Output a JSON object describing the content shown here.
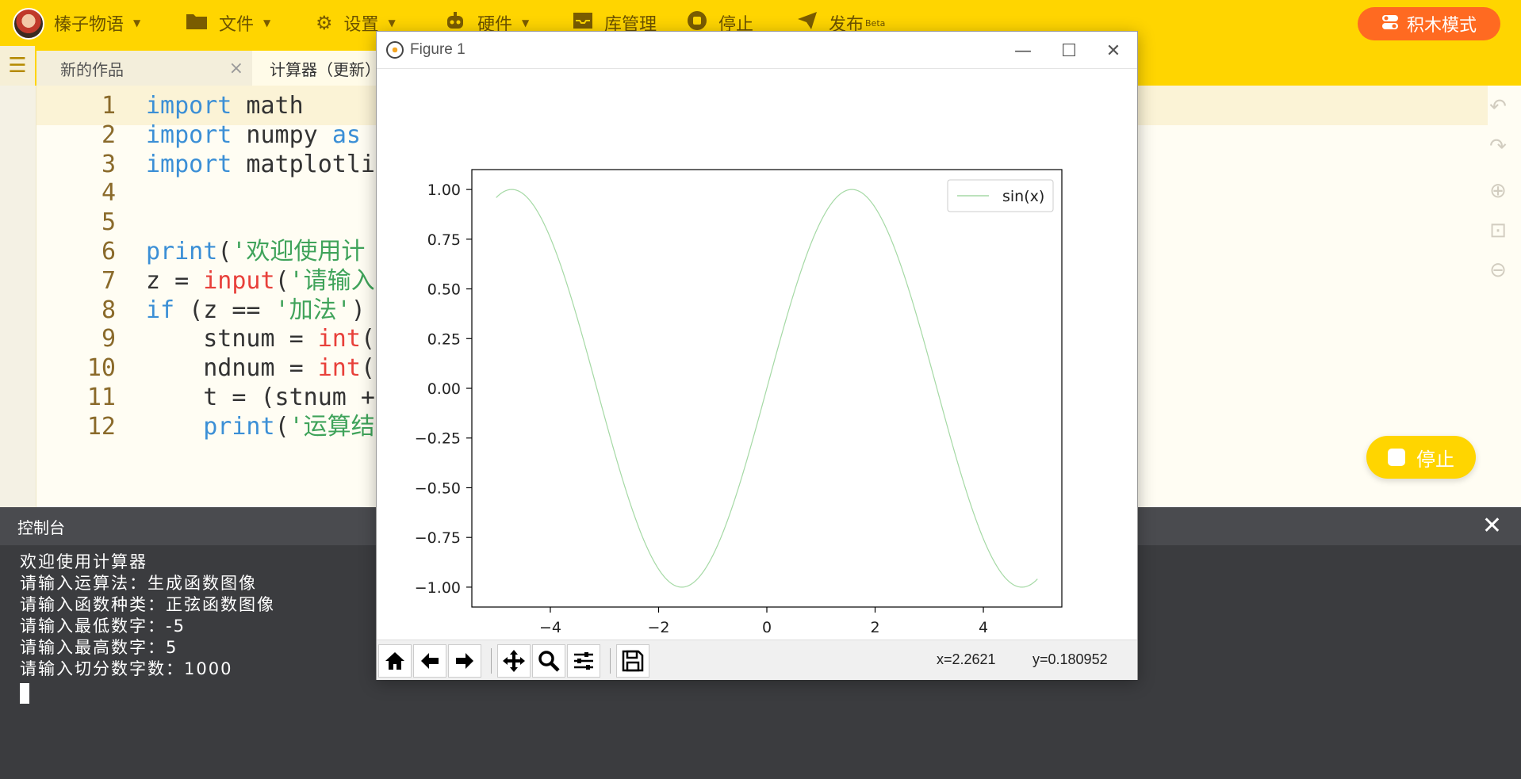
{
  "topbar": {
    "project_label": "榛子物语",
    "file_label": "文件",
    "settings_label": "设置",
    "hardware_label": "硬件",
    "library_label": "库管理",
    "stop_label": "停止",
    "publish_label": "发布",
    "publish_badge": "Beta",
    "mode_label": "积木模式"
  },
  "tabs": [
    {
      "label": "新的作品",
      "close": "×"
    },
    {
      "label": "计算器（更新）"
    }
  ],
  "editor": {
    "lines": [
      {
        "n": "1",
        "segments": [
          {
            "t": "import",
            "c": "kw"
          },
          {
            "t": " math",
            "c": ""
          }
        ]
      },
      {
        "n": "2",
        "segments": [
          {
            "t": "import",
            "c": "kw"
          },
          {
            "t": " numpy ",
            "c": ""
          },
          {
            "t": "as",
            "c": "kw"
          }
        ]
      },
      {
        "n": "3",
        "segments": [
          {
            "t": "import",
            "c": "kw"
          },
          {
            "t": " matplotli",
            "c": ""
          }
        ]
      },
      {
        "n": "4",
        "segments": []
      },
      {
        "n": "5",
        "segments": []
      },
      {
        "n": "6",
        "segments": [
          {
            "t": "print",
            "c": "kw"
          },
          {
            "t": "(",
            "c": ""
          },
          {
            "t": "'欢迎使用计",
            "c": "st"
          }
        ]
      },
      {
        "n": "7",
        "segments": [
          {
            "t": "z = ",
            "c": ""
          },
          {
            "t": "input",
            "c": "fn"
          },
          {
            "t": "(",
            "c": ""
          },
          {
            "t": "'请输入",
            "c": "st"
          }
        ]
      },
      {
        "n": "8",
        "segments": [
          {
            "t": "if",
            "c": "kw"
          },
          {
            "t": " (z == ",
            "c": ""
          },
          {
            "t": "'加法'",
            "c": "st"
          },
          {
            "t": ")",
            "c": ""
          }
        ]
      },
      {
        "n": "9",
        "segments": [
          {
            "t": "    stnum = ",
            "c": ""
          },
          {
            "t": "int",
            "c": "fn"
          },
          {
            "t": "(",
            "c": ""
          }
        ]
      },
      {
        "n": "10",
        "segments": [
          {
            "t": "    ndnum = ",
            "c": ""
          },
          {
            "t": "int",
            "c": "fn"
          },
          {
            "t": "(",
            "c": ""
          }
        ]
      },
      {
        "n": "11",
        "segments": [
          {
            "t": "    t = (stnum +",
            "c": ""
          }
        ]
      },
      {
        "n": "12",
        "segments": [
          {
            "t": "    ",
            "c": ""
          },
          {
            "t": "print",
            "c": "kw"
          },
          {
            "t": "(",
            "c": ""
          },
          {
            "t": "'运算结",
            "c": "st"
          }
        ]
      }
    ]
  },
  "floating_stop_label": "停止",
  "console": {
    "title": "控制台",
    "close": "✕",
    "lines": [
      "欢迎使用计算器",
      "请输入运算法：生成函数图像",
      "请输入函数种类：正弦函数图像",
      "请输入最低数字：-5",
      "请输入最高数字：5",
      "请输入切分数字数：1000"
    ]
  },
  "figure": {
    "title": "Figure 1",
    "x_readout": "x=2.2621",
    "y_readout": "y=0.180952"
  },
  "chart_data": {
    "type": "line",
    "title": "",
    "xlabel": "",
    "ylabel": "",
    "xlim": [
      -5.45,
      5.45
    ],
    "ylim": [
      -1.1,
      1.1
    ],
    "x_start": -5,
    "x_end": 5,
    "num_points": 1000,
    "function": "sin",
    "series": [
      {
        "name": "sin(x)",
        "color": "#a5d9a5"
      }
    ],
    "x_ticks": [
      -4,
      -2,
      0,
      2,
      4
    ],
    "x_tick_labels": [
      "−4",
      "−2",
      "0",
      "2",
      "4"
    ],
    "y_ticks": [
      1.0,
      0.75,
      0.5,
      0.25,
      0.0,
      -0.25,
      -0.5,
      -0.75,
      -1.0
    ],
    "y_tick_labels": [
      "1.00",
      "0.75",
      "0.50",
      "0.25",
      "0.00",
      "−0.25",
      "−0.50",
      "−0.75",
      "−1.00"
    ],
    "legend": "top-right",
    "grid": false
  }
}
